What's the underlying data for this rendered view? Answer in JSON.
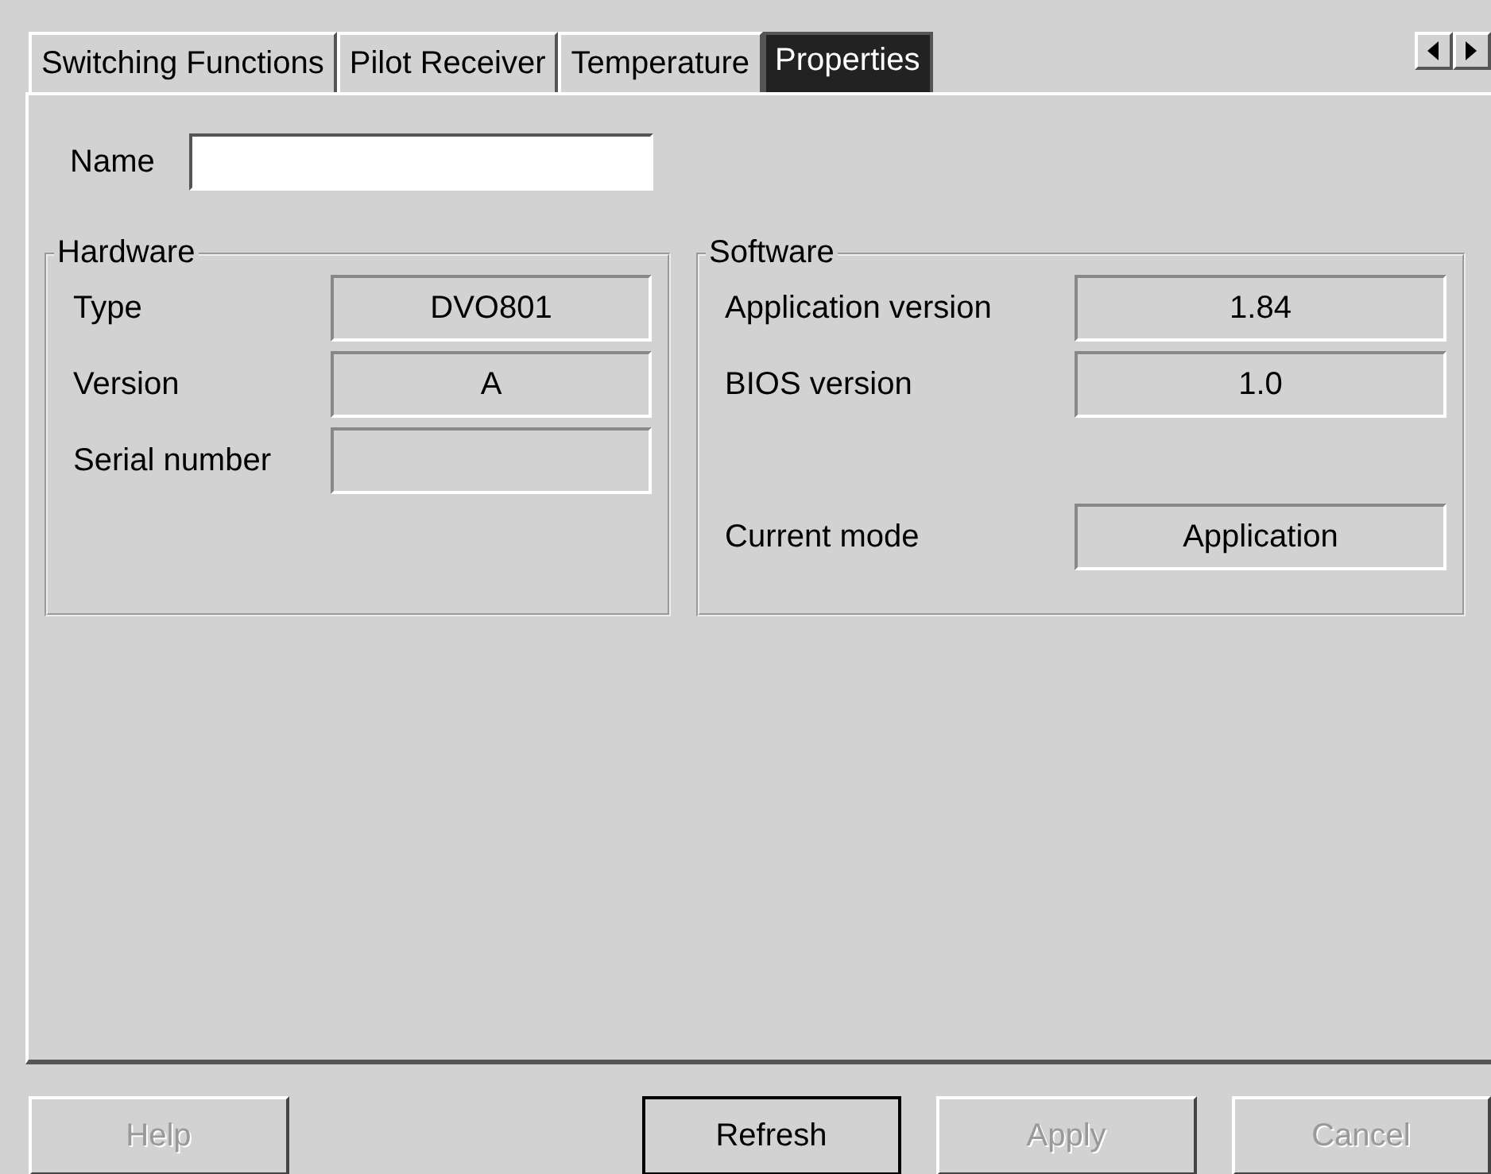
{
  "tabs": [
    {
      "label": "Switching Functions",
      "selected": false
    },
    {
      "label": "Pilot Receiver",
      "selected": false
    },
    {
      "label": "Temperature",
      "selected": false
    },
    {
      "label": "Properties",
      "selected": true
    }
  ],
  "name_field": {
    "label": "Name"
  },
  "hardware": {
    "title": "Hardware",
    "fields": [
      {
        "label": "Type",
        "value": "DVO801"
      },
      {
        "label": "Version",
        "value": "A"
      },
      {
        "label": "Serial number"
      }
    ]
  },
  "software": {
    "title": "Software",
    "fields": [
      {
        "label": "Application version",
        "value": "1.84"
      },
      {
        "label": "BIOS version",
        "value": "1.0"
      },
      {
        "label": "Current mode",
        "value": "Application"
      }
    ]
  },
  "buttons": [
    {
      "label": "Help",
      "disabled": true,
      "default": false
    },
    {
      "label": "Refresh",
      "disabled": false,
      "default": true
    },
    {
      "label": "Apply",
      "disabled": true,
      "default": false
    },
    {
      "label": "Cancel",
      "disabled": true,
      "default": false
    }
  ]
}
